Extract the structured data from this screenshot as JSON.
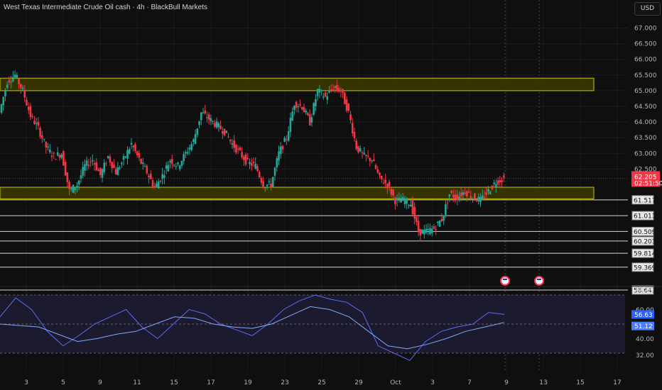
{
  "header": {
    "title": "West Texas Intermediate Crude Oil cash · 4h · BlackBull Markets",
    "currency_button": "USD"
  },
  "colors": {
    "up": "#26a69a",
    "down": "#f23645",
    "zone_fill": "#3d3a00",
    "zone_border": "#c8c800",
    "rsi": "#5b6cf0",
    "rsi_ma": "#7fa8ff",
    "rsi_band": "#1c1a2e",
    "last_price_bg": "#f23645",
    "rsi_label_bg": "#2962ff",
    "background": "#0f0f0f"
  },
  "chart_data": [
    {
      "type": "candlestick",
      "title": "West Texas Intermediate Crude Oil cash · 4h · BlackBull Markets",
      "ylim": [
        58.4,
        67.2
      ],
      "y_ticks": [
        "67.000",
        "66.500",
        "66.000",
        "65.500",
        "65.000",
        "64.500",
        "64.000",
        "63.500",
        "63.000",
        "62.500"
      ],
      "x_ticks": [
        "3",
        "5",
        "9",
        "11",
        "15",
        "17",
        "19",
        "23",
        "25",
        "29",
        "Oct",
        "3",
        "7",
        "9",
        "13",
        "15",
        "17"
      ],
      "closes": [
        64.3,
        65.3,
        65.5,
        65.0,
        64.2,
        63.8,
        63.2,
        62.9,
        63.0,
        61.8,
        62.0,
        62.6,
        62.8,
        62.3,
        62.9,
        62.4,
        62.8,
        63.3,
        62.8,
        62.4,
        61.9,
        62.3,
        62.8,
        62.6,
        63.0,
        63.4,
        64.3,
        64.1,
        63.9,
        63.7,
        63.3,
        63.0,
        62.7,
        62.6,
        62.0,
        62.0,
        63.0,
        63.5,
        64.6,
        64.5,
        64.0,
        65.0,
        64.8,
        65.1,
        65.0,
        64.3,
        63.2,
        62.9,
        62.8,
        62.2,
        62.0,
        61.5,
        61.5,
        61.4,
        60.5,
        60.5,
        60.6,
        60.9,
        61.7,
        61.6,
        61.8,
        61.6,
        61.5,
        61.8,
        62.1,
        62.205
      ],
      "last_price": {
        "value": "62.205",
        "countdown": "02:51:50"
      },
      "zones": [
        {
          "from": 65.0,
          "to": 65.4
        },
        {
          "from": 61.55,
          "to": 61.92
        }
      ],
      "levels": [
        "61.517",
        "61.013",
        "60.509",
        "60.203",
        "59.814",
        "59.369",
        "58.641"
      ],
      "events": [
        "us-flag-icon",
        "us-flag-icon"
      ]
    },
    {
      "type": "line",
      "series": [
        {
          "name": "RSI",
          "values": [
            55,
            68,
            60,
            45,
            35,
            42,
            50,
            55,
            60,
            48,
            40,
            50,
            60,
            57,
            50,
            46,
            42,
            50,
            60,
            66,
            70,
            67,
            65,
            58,
            35,
            30,
            25,
            38,
            45,
            48,
            50,
            58,
            56.63
          ]
        },
        {
          "name": "RSI MA",
          "values": [
            50,
            49,
            48,
            43,
            38,
            40,
            43,
            45,
            50,
            55,
            54,
            50,
            48,
            47,
            50,
            56,
            62,
            60,
            55,
            45,
            35,
            33,
            36,
            40,
            45,
            48,
            51.12
          ]
        }
      ],
      "ylim": [
        25,
        82
      ],
      "y_ticks": [
        "80.00",
        "60.00",
        "40.00",
        "32.00"
      ],
      "current": {
        "rsi": "56.63",
        "ma": "51.12"
      },
      "bands": [
        30,
        70
      ]
    }
  ]
}
